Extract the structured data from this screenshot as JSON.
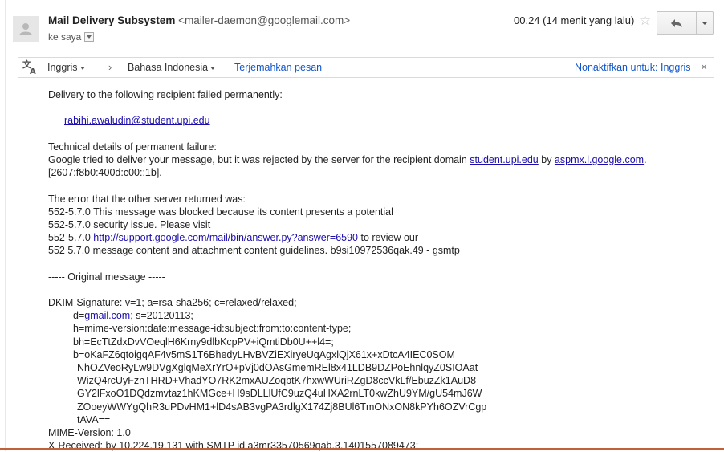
{
  "header": {
    "sender_name": "Mail Delivery Subsystem",
    "sender_email": "<mailer-daemon@googlemail.com>",
    "to_label": "ke saya",
    "time": "00.24 (14 menit yang lalu)"
  },
  "translate_bar": {
    "source_lang": "Inggris",
    "arrow": "›",
    "target_lang": "Bahasa Indonesia",
    "translate_link": "Terjemahkan pesan",
    "disable_link": "Nonaktifkan untuk: Inggris",
    "close": "×"
  },
  "body": {
    "l1": "Delivery to the following recipient failed permanently:",
    "recipient": "rabihi.awaludin@student.upi.edu",
    "l3": "Technical details of permanent failure:",
    "l4a": "Google tried to deliver your message, but it was rejected by the server for the recipient domain ",
    "l4_domain": "student.upi.edu",
    "l4b": " by ",
    "l4_mx": "aspmx.l.google.com",
    "l4c": ".",
    "l5": "[2607:f8b0:400d:c00::1b].",
    "l6": "The error that the other server returned was:",
    "l7": "552-5.7.0 This message was blocked because its content presents a potential",
    "l8": "552-5.7.0 security issue. Please visit",
    "l9a": "552-5.7.0 ",
    "l9_link": "http://support.google.com/mail/bin/answer.py?answer=6590",
    "l9b": " to review our",
    "l10": "552 5.7.0 message content and attachment content guidelines. b9si10972536qak.49 - gsmtp",
    "l11": "----- Original message -----",
    "l12": "DKIM-Signature: v=1; a=rsa-sha256; c=relaxed/relaxed;",
    "l13a": "d=",
    "l13_link": "gmail.com",
    "l13b": "; s=20120113;",
    "l14": "h=mime-version:date:message-id:subject:from:to:content-type;",
    "l15": "bh=EcTtZdxDvVOeqlH6Krny9dlbKcpPV+iQmtiDb0U++l4=;",
    "l16": "b=oKaFZ6qtoigqAF4v5mS1T6BhedyLHvBVZiEXiryeUqAgxlQjX61x+xDtcA4IEC0SOM",
    "l17": "NhOZVeoRyLw9DVgXglqMeXrYrO+pVj0dOAsGmemREl8x41LDB9DZPoEhnlqyZ0SIOAat",
    "l18": "WizQ4rcUyFznTHRD+VhadYO7RK2mxAUZoqbtK7hxwWUriRZgD8ccVkLf/EbuzZk1AuD8",
    "l19": "GY2lFxoO1DQdzmvtaz1hKMGce+H9sDLLlUfC9uzQ4uHXA2rnLT0kwZhU9YM/gU54mJ6W",
    "l20": "ZOoeyWWYgQhR3uPDvHM1+lD4sAB3vgPA3rdlgX174Zj8BUl6TmONxON8kPYh6OZVrCgp",
    "l21": "tAVA==",
    "l22": "MIME-Version: 1.0",
    "l23": "X-Received: by 10.224.19.131 with SMTP id a3mr33570569qab.3.1401557089473;"
  }
}
